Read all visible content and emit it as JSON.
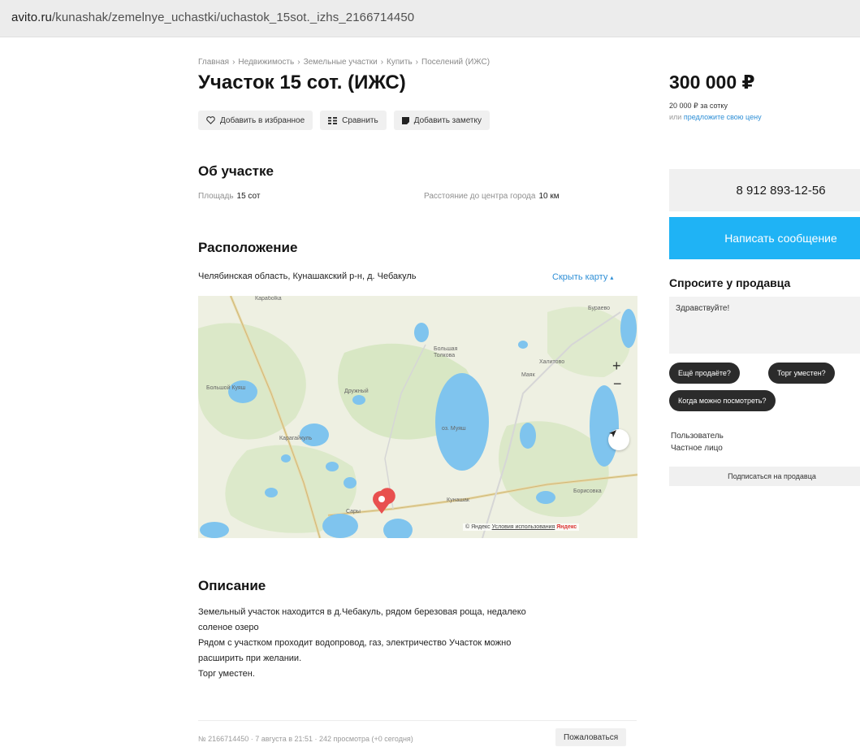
{
  "browser": {
    "url_domain": "avito.ru",
    "url_path": "/kunashak/zemelnye_uchastki/uchastok_15sot._izhs_2166714450"
  },
  "breadcrumb": [
    "Главная",
    "Недвижимость",
    "Земельные участки",
    "Купить",
    "Поселений (ИЖС)"
  ],
  "listing": {
    "title": "Участок 15 сот. (ИЖС)",
    "actions": {
      "favorite": "Добавить в избранное",
      "compare": "Сравнить",
      "note": "Добавить заметку"
    }
  },
  "about": {
    "heading": "Об участке",
    "area_label": "Площадь",
    "area_value": "15 сот",
    "distance_label": "Расстояние до центра города",
    "distance_value": "10 км"
  },
  "location": {
    "heading": "Расположение",
    "address": "Челябинская область, Кунашакский р-н, д. Чебакуль",
    "hide_map": "Скрыть карту",
    "map": {
      "labels": [
        "Карабolka",
        "Бураево",
        "Большая Толкова",
        "Халитово",
        "Маяк",
        "Большой Куяш",
        "Дружный",
        "оз. Муяш",
        "Карагайкуль",
        "Кунашак",
        "Борисовка",
        "Сары"
      ],
      "zoom_in": "+",
      "zoom_out": "−",
      "copyright_brand": "© Яндекс",
      "copyright_terms": "Условия использования",
      "copyright_logo": "Яндекс"
    }
  },
  "description": {
    "heading": "Описание",
    "lines": [
      "Земельный участок находится в д.Чебакуль, рядом березовая роща, недалеко",
      "соленое озеро",
      "Рядом с участком проходит водопровод, газ, электричество Участок можно",
      "расширить при желании.",
      "Торг уместен."
    ]
  },
  "footer": {
    "info": "№ 2166714450 · 7 августа в 21:51 · 242 просмотра (+0 сегодня)",
    "complain": "Пожаловаться"
  },
  "sidebar": {
    "price": "300 000 ₽",
    "per_unit": "20 000 ₽ за сотку",
    "offer_prefix": "или",
    "offer_link": "предложите свою цену",
    "phone": "8 912 893-12-56",
    "message_button": "Написать сообщение",
    "ask_title": "Спросите у продавца",
    "ask_placeholder": "Здравствуйте!",
    "chips": [
      "Ещё продаёте?",
      "Торг уместен?",
      "Когда можно посмотреть?"
    ],
    "seller_name": "Пользователь",
    "seller_type": "Частное лицо",
    "subscribe": "Подписаться на продавца"
  },
  "colors": {
    "accent_blue": "#1fb3f5",
    "link_blue": "#2f8fd6",
    "map_pin": "#e8504f",
    "water": "#7fc4ee"
  }
}
